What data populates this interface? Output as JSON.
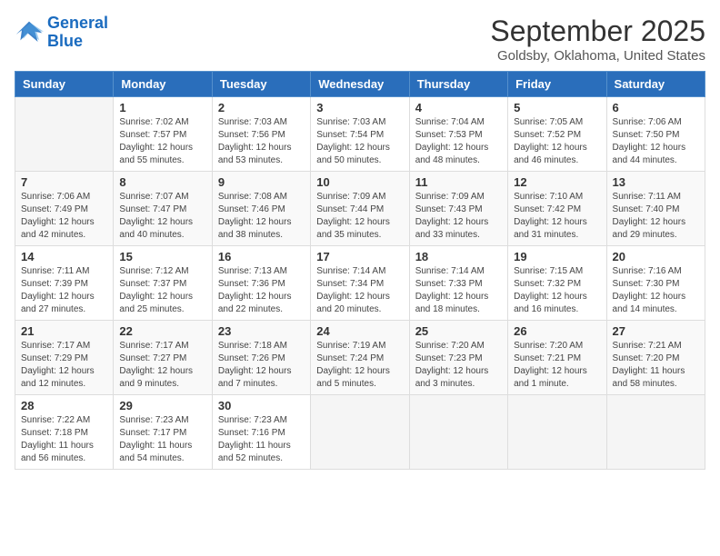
{
  "header": {
    "logo_line1": "General",
    "logo_line2": "Blue",
    "month": "September 2025",
    "location": "Goldsby, Oklahoma, United States"
  },
  "days_of_week": [
    "Sunday",
    "Monday",
    "Tuesday",
    "Wednesday",
    "Thursday",
    "Friday",
    "Saturday"
  ],
  "weeks": [
    [
      {
        "day": "",
        "info": ""
      },
      {
        "day": "1",
        "info": "Sunrise: 7:02 AM\nSunset: 7:57 PM\nDaylight: 12 hours\nand 55 minutes."
      },
      {
        "day": "2",
        "info": "Sunrise: 7:03 AM\nSunset: 7:56 PM\nDaylight: 12 hours\nand 53 minutes."
      },
      {
        "day": "3",
        "info": "Sunrise: 7:03 AM\nSunset: 7:54 PM\nDaylight: 12 hours\nand 50 minutes."
      },
      {
        "day": "4",
        "info": "Sunrise: 7:04 AM\nSunset: 7:53 PM\nDaylight: 12 hours\nand 48 minutes."
      },
      {
        "day": "5",
        "info": "Sunrise: 7:05 AM\nSunset: 7:52 PM\nDaylight: 12 hours\nand 46 minutes."
      },
      {
        "day": "6",
        "info": "Sunrise: 7:06 AM\nSunset: 7:50 PM\nDaylight: 12 hours\nand 44 minutes."
      }
    ],
    [
      {
        "day": "7",
        "info": "Sunrise: 7:06 AM\nSunset: 7:49 PM\nDaylight: 12 hours\nand 42 minutes."
      },
      {
        "day": "8",
        "info": "Sunrise: 7:07 AM\nSunset: 7:47 PM\nDaylight: 12 hours\nand 40 minutes."
      },
      {
        "day": "9",
        "info": "Sunrise: 7:08 AM\nSunset: 7:46 PM\nDaylight: 12 hours\nand 38 minutes."
      },
      {
        "day": "10",
        "info": "Sunrise: 7:09 AM\nSunset: 7:44 PM\nDaylight: 12 hours\nand 35 minutes."
      },
      {
        "day": "11",
        "info": "Sunrise: 7:09 AM\nSunset: 7:43 PM\nDaylight: 12 hours\nand 33 minutes."
      },
      {
        "day": "12",
        "info": "Sunrise: 7:10 AM\nSunset: 7:42 PM\nDaylight: 12 hours\nand 31 minutes."
      },
      {
        "day": "13",
        "info": "Sunrise: 7:11 AM\nSunset: 7:40 PM\nDaylight: 12 hours\nand 29 minutes."
      }
    ],
    [
      {
        "day": "14",
        "info": "Sunrise: 7:11 AM\nSunset: 7:39 PM\nDaylight: 12 hours\nand 27 minutes."
      },
      {
        "day": "15",
        "info": "Sunrise: 7:12 AM\nSunset: 7:37 PM\nDaylight: 12 hours\nand 25 minutes."
      },
      {
        "day": "16",
        "info": "Sunrise: 7:13 AM\nSunset: 7:36 PM\nDaylight: 12 hours\nand 22 minutes."
      },
      {
        "day": "17",
        "info": "Sunrise: 7:14 AM\nSunset: 7:34 PM\nDaylight: 12 hours\nand 20 minutes."
      },
      {
        "day": "18",
        "info": "Sunrise: 7:14 AM\nSunset: 7:33 PM\nDaylight: 12 hours\nand 18 minutes."
      },
      {
        "day": "19",
        "info": "Sunrise: 7:15 AM\nSunset: 7:32 PM\nDaylight: 12 hours\nand 16 minutes."
      },
      {
        "day": "20",
        "info": "Sunrise: 7:16 AM\nSunset: 7:30 PM\nDaylight: 12 hours\nand 14 minutes."
      }
    ],
    [
      {
        "day": "21",
        "info": "Sunrise: 7:17 AM\nSunset: 7:29 PM\nDaylight: 12 hours\nand 12 minutes."
      },
      {
        "day": "22",
        "info": "Sunrise: 7:17 AM\nSunset: 7:27 PM\nDaylight: 12 hours\nand 9 minutes."
      },
      {
        "day": "23",
        "info": "Sunrise: 7:18 AM\nSunset: 7:26 PM\nDaylight: 12 hours\nand 7 minutes."
      },
      {
        "day": "24",
        "info": "Sunrise: 7:19 AM\nSunset: 7:24 PM\nDaylight: 12 hours\nand 5 minutes."
      },
      {
        "day": "25",
        "info": "Sunrise: 7:20 AM\nSunset: 7:23 PM\nDaylight: 12 hours\nand 3 minutes."
      },
      {
        "day": "26",
        "info": "Sunrise: 7:20 AM\nSunset: 7:21 PM\nDaylight: 12 hours\nand 1 minute."
      },
      {
        "day": "27",
        "info": "Sunrise: 7:21 AM\nSunset: 7:20 PM\nDaylight: 11 hours\nand 58 minutes."
      }
    ],
    [
      {
        "day": "28",
        "info": "Sunrise: 7:22 AM\nSunset: 7:18 PM\nDaylight: 11 hours\nand 56 minutes."
      },
      {
        "day": "29",
        "info": "Sunrise: 7:23 AM\nSunset: 7:17 PM\nDaylight: 11 hours\nand 54 minutes."
      },
      {
        "day": "30",
        "info": "Sunrise: 7:23 AM\nSunset: 7:16 PM\nDaylight: 11 hours\nand 52 minutes."
      },
      {
        "day": "",
        "info": ""
      },
      {
        "day": "",
        "info": ""
      },
      {
        "day": "",
        "info": ""
      },
      {
        "day": "",
        "info": ""
      }
    ]
  ]
}
